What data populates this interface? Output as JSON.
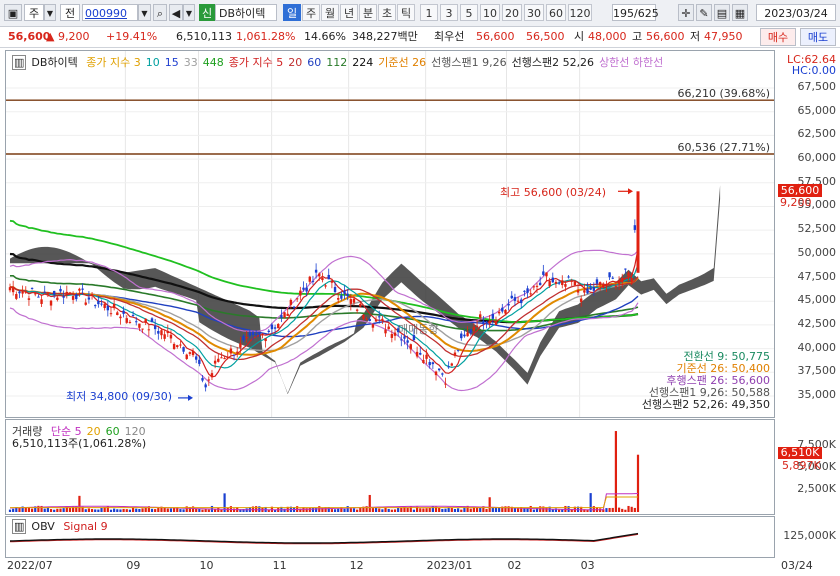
{
  "toolbar": {
    "type_label": "주",
    "type2_label": "전",
    "code": "000990",
    "stock_name": "DB하이텍",
    "stock_badge": "신",
    "periods": [
      "일",
      "주",
      "월",
      "년",
      "분",
      "초",
      "틱"
    ],
    "selected_period": "일",
    "numbers": [
      "1",
      "3",
      "5",
      "10",
      "20",
      "30",
      "60",
      "120"
    ],
    "count": "195",
    "total": "/625",
    "date": "2023/03/24"
  },
  "price": {
    "current": "56,600",
    "change": "9,200",
    "change_pct": "+19.41%",
    "volume": "6,510,113",
    "volume_ratio": "1,061.28%",
    "turnover": "14.66%",
    "amount": "348,227백만",
    "best_label": "최우선",
    "best_ask": "56,600",
    "best_bid": "56,500",
    "open_label": "시",
    "open": "48,000",
    "high_label": "고",
    "high": "56,600",
    "low_label": "저",
    "low": "47,950",
    "buy_button": "매수",
    "sell_button": "매도"
  },
  "main_legend": {
    "title": "DB하이텍",
    "items": [
      {
        "text": "종가 지수 3",
        "color": "#e0a000"
      },
      {
        "text": "10",
        "color": "#00a0a0"
      },
      {
        "text": "15",
        "color": "#2040d0"
      },
      {
        "text": "33",
        "color": "#a0a0a0"
      },
      {
        "text": "448",
        "color": "#20a020"
      },
      {
        "text": "종가 지수 5",
        "color": "#d02020"
      },
      {
        "text": "20",
        "color": "#c03030"
      },
      {
        "text": "60",
        "color": "#2040c0"
      },
      {
        "text": "112",
        "color": "#2a7a2a"
      },
      {
        "text": "224",
        "color": "#111111"
      },
      {
        "text": "기준선 26",
        "color": "#e08000"
      },
      {
        "text": "선행스팬1 9,26",
        "color": "#555555"
      },
      {
        "text": "선행스팬2 52,26",
        "color": "#222222"
      },
      {
        "text": "상한선 하한선",
        "color": "#c070d0"
      }
    ]
  },
  "levels": [
    {
      "label": "66,210 (39.68%)",
      "value": 66210
    },
    {
      "label": "60,536 (27.71%)",
      "value": 60536
    }
  ],
  "hl": {
    "lc": "LC:62.64",
    "hc": "HC:0.00"
  },
  "annotations": {
    "high": "최고 56,600 (03/24)",
    "low": "최저 34,800 (09/30)",
    "watermark": "매매동향"
  },
  "indicator_values": [
    {
      "text": "전환선 9: 50,775",
      "color": "#1a8a60"
    },
    {
      "text": "기준선 26: 50,400",
      "color": "#e08000"
    },
    {
      "text": "후행스팬 26: 56,600",
      "color": "#9040b0"
    },
    {
      "text": "선행스팬1 9,26: 50,588",
      "color": "#555555"
    },
    {
      "text": "선행스팬2 52,26: 49,350",
      "color": "#222222"
    }
  ],
  "price_axis": [
    "67,500",
    "65,000",
    "62,500",
    "60,000",
    "57,500",
    "55,000",
    "52,500",
    "50,000",
    "47,500",
    "45,000",
    "42,500",
    "40,000",
    "37,500",
    "35,000"
  ],
  "price_axis_values": [
    67500,
    65000,
    62500,
    60000,
    57500,
    55000,
    52500,
    50000,
    47500,
    45000,
    42500,
    40000,
    37500,
    35000
  ],
  "current_tag": "56,600",
  "current_tag_sub": "9,200",
  "volume_legend": {
    "title": "거래량",
    "items": [
      {
        "text": "단순 5",
        "color": "#c030c0"
      },
      {
        "text": "20",
        "color": "#e0a000"
      },
      {
        "text": "60",
        "color": "#20a020"
      },
      {
        "text": "120",
        "color": "#888888"
      }
    ],
    "value": "6,510,113주(1,061.28%)"
  },
  "volume_axis": [
    "7,500K",
    "5,000K",
    "2,500K"
  ],
  "volume_axis_values": [
    7500,
    5000,
    2500
  ],
  "volume_tag": "6,510K",
  "volume_tag_sub": "5,897K",
  "obv_legend": {
    "title": "OBV",
    "signal": "Signal 9"
  },
  "obv_axis": [
    "125,000K"
  ],
  "x_axis": [
    {
      "label": "2022/07",
      "pos": 0.0
    },
    {
      "label": "09",
      "pos": 0.155
    },
    {
      "label": "10",
      "pos": 0.25
    },
    {
      "label": "11",
      "pos": 0.345
    },
    {
      "label": "12",
      "pos": 0.445
    },
    {
      "label": "2023/01",
      "pos": 0.545
    },
    {
      "label": "02",
      "pos": 0.65
    },
    {
      "label": "03",
      "pos": 0.745
    },
    {
      "label": "03/24",
      "pos": 1.0
    }
  ]
}
